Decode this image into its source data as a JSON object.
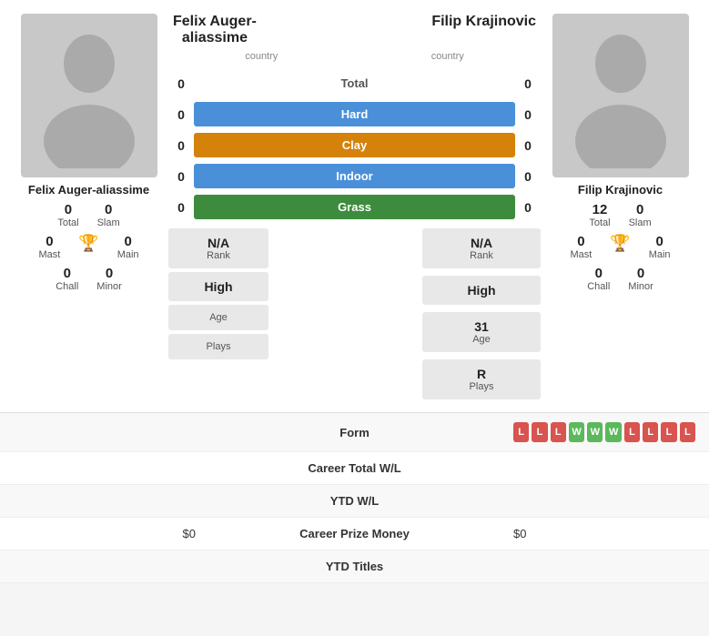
{
  "players": {
    "left": {
      "name": "Felix Auger-aliassime",
      "name_display": "Felix Auger-\naliassime",
      "country": "country",
      "stats": {
        "total": "0",
        "total_label": "Total",
        "slam": "0",
        "slam_label": "Slam",
        "mast": "0",
        "mast_label": "Mast",
        "main": "0",
        "main_label": "Main",
        "chall": "0",
        "chall_label": "Chall",
        "minor": "0",
        "minor_label": "Minor"
      },
      "info": {
        "rank_value": "N/A",
        "rank_label": "Rank",
        "high_value": "High",
        "high_label": "",
        "age_value": "",
        "age_label": "Age",
        "plays_value": "",
        "plays_label": "Plays"
      }
    },
    "right": {
      "name": "Filip Krajinovic",
      "country": "country",
      "stats": {
        "total": "12",
        "total_label": "Total",
        "slam": "0",
        "slam_label": "Slam",
        "mast": "0",
        "mast_label": "Mast",
        "main": "0",
        "main_label": "Main",
        "chall": "0",
        "chall_label": "Chall",
        "minor": "0",
        "minor_label": "Minor"
      },
      "info": {
        "rank_value": "N/A",
        "rank_label": "Rank",
        "high_value": "High",
        "high_label": "",
        "age_value": "31",
        "age_label": "Age",
        "plays_value": "R",
        "plays_label": "Plays"
      }
    }
  },
  "surfaces": {
    "total": {
      "label": "Total",
      "score_left": "0",
      "score_right": "0"
    },
    "hard": {
      "label": "Hard",
      "score_left": "0",
      "score_right": "0"
    },
    "clay": {
      "label": "Clay",
      "score_left": "0",
      "score_right": "0"
    },
    "indoor": {
      "label": "Indoor",
      "score_left": "0",
      "score_right": "0"
    },
    "grass": {
      "label": "Grass",
      "score_left": "0",
      "score_right": "0"
    }
  },
  "bottom_stats": {
    "form": {
      "label": "Form",
      "badges": [
        "L",
        "L",
        "L",
        "W",
        "W",
        "W",
        "L",
        "L",
        "L",
        "L"
      ]
    },
    "career_wl": {
      "label": "Career Total W/L",
      "left": "",
      "right": ""
    },
    "ytd_wl": {
      "label": "YTD W/L",
      "left": "",
      "right": ""
    },
    "career_prize": {
      "label": "Career Prize Money",
      "left": "$0",
      "right": "$0"
    },
    "ytd_titles": {
      "label": "YTD Titles",
      "left": "",
      "right": ""
    }
  },
  "colors": {
    "hard": "#4a90d9",
    "clay": "#d4820a",
    "indoor": "#4a90d9",
    "grass": "#3d8c3d",
    "win": "#5cb85c",
    "loss": "#d9534f",
    "trophy": "#4a90d9"
  }
}
